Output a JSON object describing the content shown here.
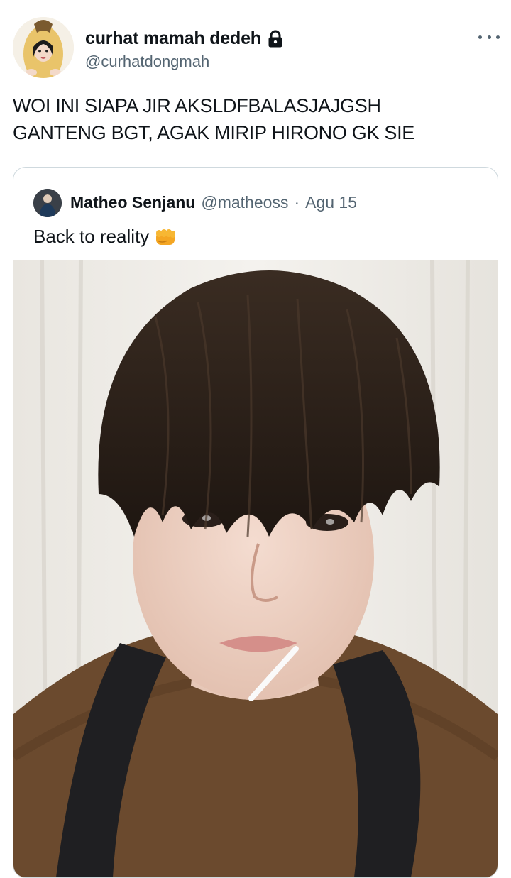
{
  "tweet": {
    "display_name": "curhat mamah dedeh",
    "handle": "@curhatdongmah",
    "text": "WOI INI SIAPA JIR AKSLDFBALASJAJGSH\nGANTENG BGT, AGAK MIRIP HIRONO GK SIE",
    "verified_icon": "lock-icon",
    "more_icon": "more-horizontal-icon"
  },
  "quoted_tweet": {
    "display_name": "Matheo Senjanu",
    "handle": "@matheoss",
    "separator": "·",
    "date": "Agu 15",
    "text": "Back to reality",
    "emoji_icon": "fist-icon"
  },
  "colors": {
    "text_primary": "#0f1419",
    "text_secondary": "#536471",
    "border": "#cfd9de"
  }
}
